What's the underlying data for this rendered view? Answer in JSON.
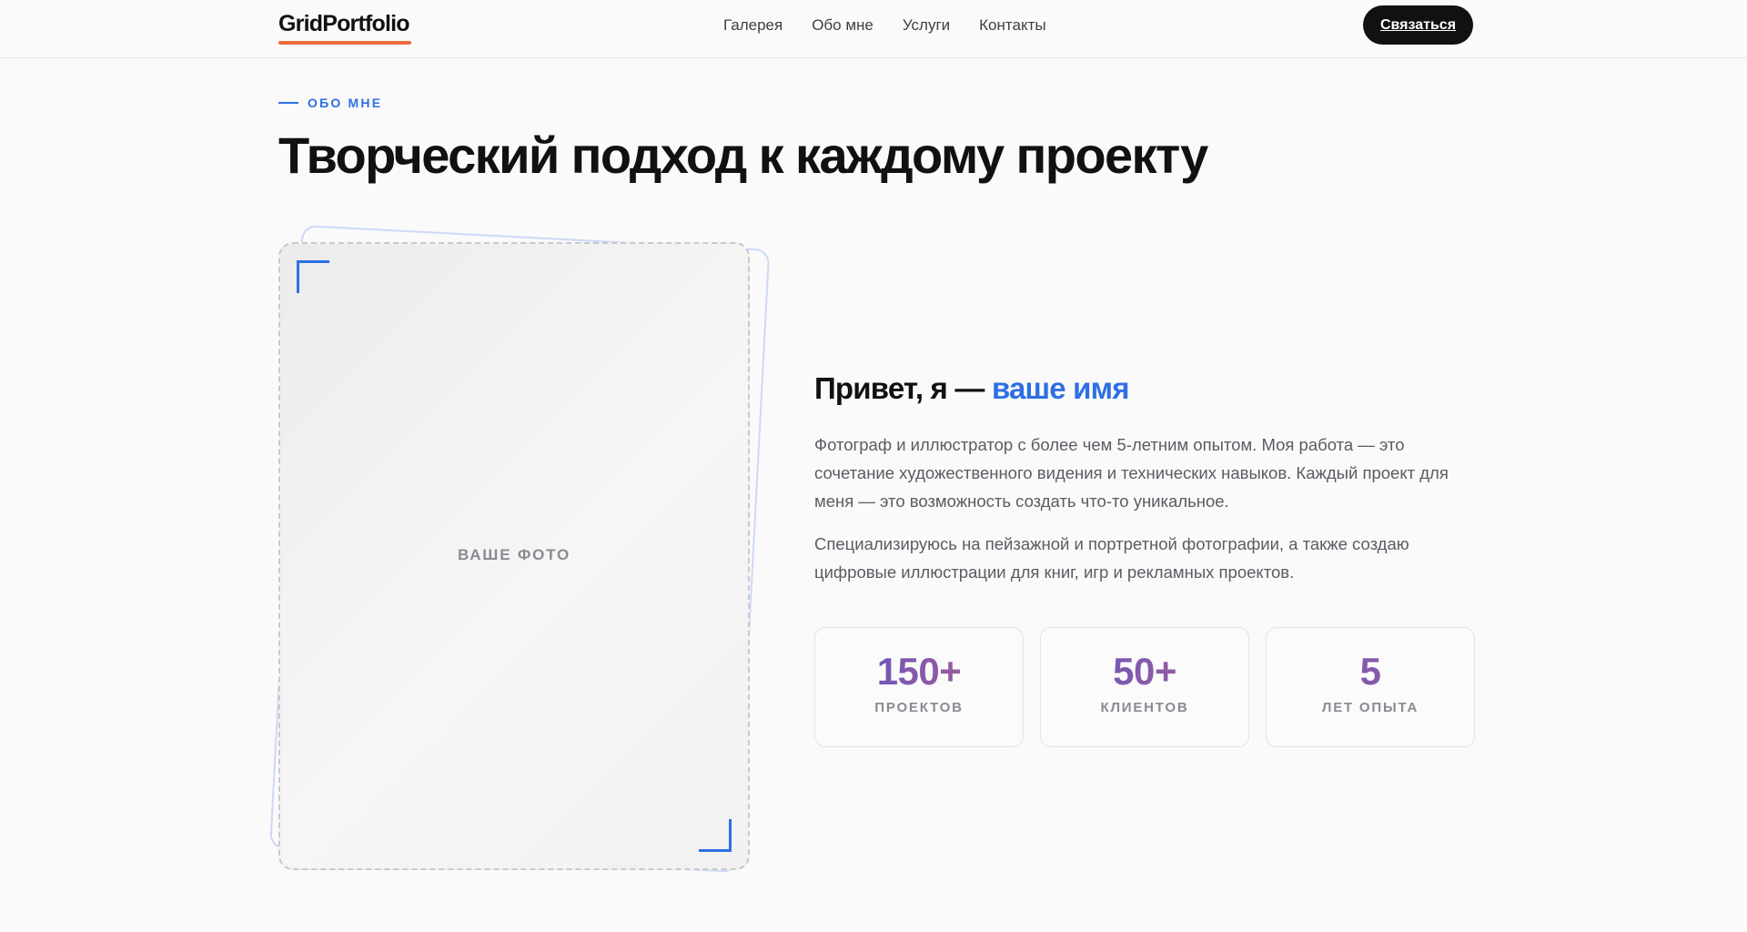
{
  "header": {
    "logo": "GridPortfolio",
    "nav": [
      "Галерея",
      "Обо мне",
      "Услуги",
      "Контакты"
    ],
    "cta_label": "Связаться"
  },
  "section": {
    "eyebrow": "ОБО МНЕ",
    "title": "Творческий подход к каждому проекту"
  },
  "photo": {
    "placeholder": "ВАШЕ ФОТО"
  },
  "about": {
    "greeting_prefix": "Привет, я —",
    "greeting_name": "ваше имя",
    "paragraph1": "Фотограф и иллюстратор с более чем 5-летним опытом. Моя работа — это сочетание художественного видения и технических навыков. Каждый проект для меня — это возможность создать что-то уникальное.",
    "paragraph2": "Специализируюсь на пейзажной и портретной фотографии, а также создаю цифровые иллюстрации для книг, игр и рекламных проектов."
  },
  "stats": [
    {
      "value": "150+",
      "label": "ПРОЕКТОВ"
    },
    {
      "value": "50+",
      "label": "КЛИЕНТОВ"
    },
    {
      "value": "5",
      "label": "ЛЕТ ОПЫТА"
    }
  ],
  "colors": {
    "accent": "#2f6fe4",
    "logo_underline": "#ec6a3c",
    "cta_background": "#111111"
  }
}
